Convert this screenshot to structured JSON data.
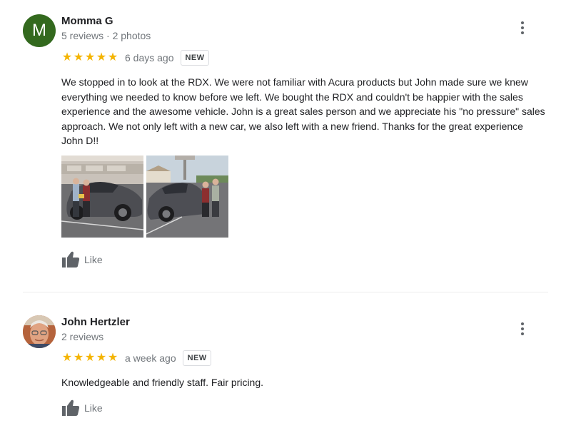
{
  "reviews": [
    {
      "avatar_letter": "M",
      "avatar_color": "#33691e",
      "name": "Momma G",
      "meta": "5 reviews · 2 photos",
      "rating": 5,
      "date": "6 days ago",
      "badge": "NEW",
      "text": "We stopped in to look at the RDX.  We were not familiar with Acura products but John made sure we knew everything we needed to know before we left.  We bought the RDX and couldn't be happier with the sales experience and the awesome vehicle.  John is a great sales person and we appreciate his \"no pressure\" sales approach. We not only left with a new car, we also left with a new friend.  Thanks for the great experience John D!!",
      "like_label": "Like"
    },
    {
      "name": "John Hertzler",
      "meta": "2 reviews",
      "rating": 5,
      "date": "a week ago",
      "badge": "NEW",
      "text": "Knowledgeable and friendly staff. Fair pricing.",
      "like_label": "Like"
    }
  ],
  "icons": {
    "star": "★",
    "more": "more-vert-icon",
    "like": "thumb-up-icon"
  },
  "colors": {
    "star": "#f4b400",
    "secondary_text": "#70757a",
    "divider": "#ececec"
  }
}
